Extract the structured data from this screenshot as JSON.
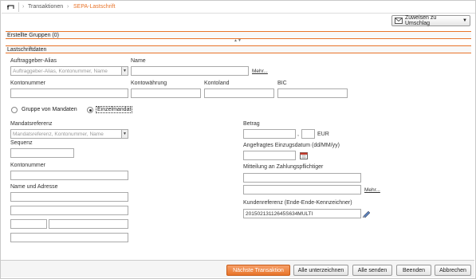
{
  "breadcrumb": {
    "items": [
      "Transaktionen",
      "SEPA-Lastschrift"
    ],
    "separator": "›"
  },
  "toolbar": {
    "assign_label": "Zuweisen zu Umschlag"
  },
  "groups": {
    "created_groups": "Erstellte Gruppen (0)",
    "debit_data": "Lastschriftdaten"
  },
  "creditor": {
    "alias_label": "Auftraggeber-Alias",
    "alias_placeholder": "Auftraggeber-Alias, Kontonummer, Name",
    "name_label": "Name",
    "more_link": "Mehr...",
    "account_label": "Kontonummer",
    "currency_label": "Kontowährung",
    "country_label": "Kontoland",
    "bic_label": "BIC"
  },
  "mode": {
    "option_group": "Gruppe von Mandaten",
    "option_single": "Einzelmandat",
    "selected": "Einzelmandat"
  },
  "mandate": {
    "reference_label": "Mandatsreferenz",
    "reference_placeholder": "Mandatsreferenz, Kontonummer, Name",
    "sequence_label": "Sequenz",
    "account_label": "Kontonummer",
    "name_address_label": "Name und Adresse"
  },
  "payment": {
    "amount_label": "Betrag",
    "amount_decimal_sep": ",",
    "currency": "EUR",
    "date_label": "Angefragtes Einzugsdatum (dd/MM/yy)",
    "message_label": "Mitteilung an Zahlungspflichtiger",
    "more_link": "Mehr...",
    "customer_ref_label": "Kundenreferenz (Ende-Ende-Kennzeichner)",
    "customer_ref_value": "20150213112645S634MULTI"
  },
  "footer": {
    "next_transaction": "Nächste Transaktion",
    "sign_all": "Alle unterzeichnen",
    "send_all": "Alle senden",
    "finish": "Beenden",
    "cancel": "Abbrechen"
  },
  "colors": {
    "accent": "#e8742a",
    "border": "#aaaaaa"
  }
}
